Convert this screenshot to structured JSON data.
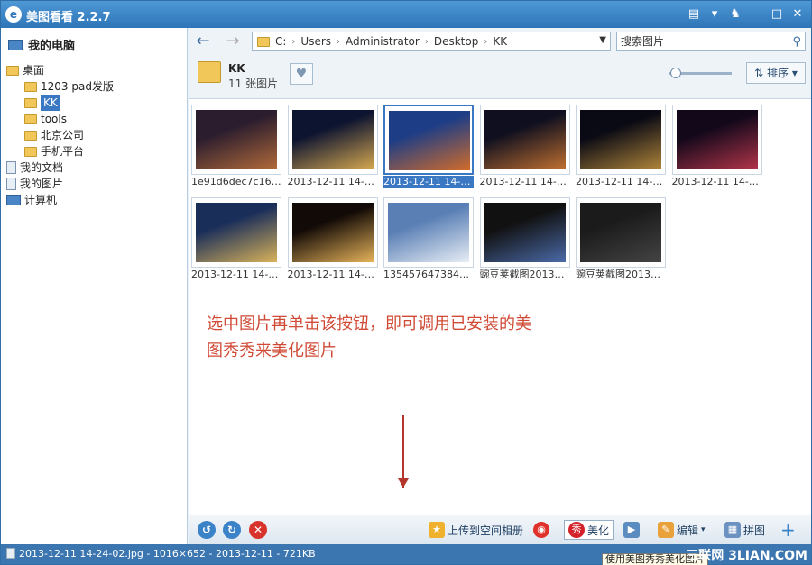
{
  "window": {
    "title": "美图看看 2.2.7"
  },
  "sidebar": {
    "head": "我的电脑",
    "items": [
      {
        "label": "桌面",
        "level": 0,
        "icon": "folder-icon"
      },
      {
        "label": "1203 pad发版",
        "level": 1,
        "icon": "folder-icon"
      },
      {
        "label": "KK",
        "level": 1,
        "icon": "folder-icon",
        "selected": true
      },
      {
        "label": "tools",
        "level": 1,
        "icon": "folder-icon"
      },
      {
        "label": "北京公司",
        "level": 1,
        "icon": "folder-icon"
      },
      {
        "label": "手机平台",
        "level": 1,
        "icon": "folder-icon"
      },
      {
        "label": "我的文档",
        "level": 0,
        "icon": "document-icon"
      },
      {
        "label": "我的图片",
        "level": 0,
        "icon": "pictures-icon"
      },
      {
        "label": "计算机",
        "level": 0,
        "icon": "computer-icon"
      }
    ]
  },
  "nav": {
    "path": [
      "C:",
      "Users",
      "Administrator",
      "Desktop",
      "KK"
    ],
    "search_placeholder": "搜索图片"
  },
  "folder": {
    "name": "KK",
    "count": "11 张图片",
    "sort_label": "排序"
  },
  "thumbnails": [
    {
      "caption": "1e91d6dec7c163...",
      "colors": [
        "#2b1d2e",
        "#b26a3a"
      ]
    },
    {
      "caption": "2013-12-11 14-2...",
      "colors": [
        "#0d1430",
        "#d6a850"
      ]
    },
    {
      "caption": "2013-12-11 14-2...",
      "colors": [
        "#1d3d86",
        "#d26c2a"
      ],
      "selected": true
    },
    {
      "caption": "2013-12-11 14-2...",
      "colors": [
        "#0f0f1f",
        "#c07030"
      ]
    },
    {
      "caption": "2013-12-11 14-2...",
      "colors": [
        "#0a0a14",
        "#b0853a"
      ]
    },
    {
      "caption": "2013-12-11 14-2...",
      "colors": [
        "#12081a",
        "#b2344a"
      ]
    },
    {
      "caption": "2013-12-11 14-2...",
      "colors": [
        "#1a2e5a",
        "#d9b35a"
      ]
    },
    {
      "caption": "2013-12-11 14-2...",
      "colors": [
        "#120a06",
        "#e6b35a"
      ]
    },
    {
      "caption": "1354576473843.j...",
      "colors": [
        "#5a7fb5",
        "#e8eef5"
      ]
    },
    {
      "caption": "豌豆荚截图20131...",
      "colors": [
        "#111111",
        "#4a6aa8"
      ]
    },
    {
      "caption": "豌豆荚截图20131...",
      "colors": [
        "#1b1b1b",
        "#444444"
      ]
    }
  ],
  "annotation": {
    "line1": "选中图片再单击该按钮，即可调用已安装的美",
    "line2": "图秀秀来美化图片"
  },
  "toolbar": {
    "upload_label": "上传到空间相册",
    "beautify_label": "美化",
    "edit_label": "编辑",
    "collage_label": "拼图"
  },
  "status": {
    "text": "2013-12-11 14-24-02.jpg - 1016×652 - 2013-12-11 - 721KB",
    "tooltip": "使用美图秀秀美化图片",
    "watermark": "三联网 3LIAN.COM"
  },
  "colors": {
    "selection": "#3a78c3",
    "annotation": "#d04a36",
    "titlebar": "#2d75b8"
  }
}
